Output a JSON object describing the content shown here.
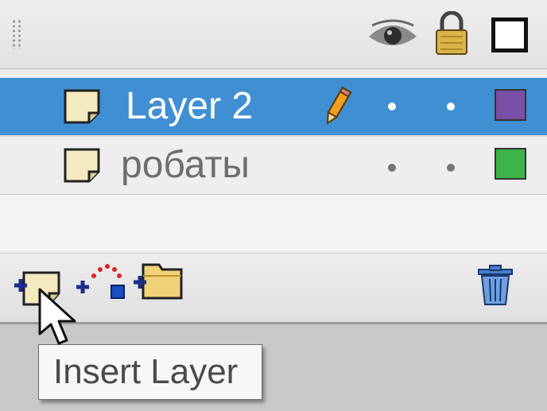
{
  "header": {
    "icons": [
      "eye-icon",
      "lock-icon",
      "outline-icon"
    ]
  },
  "layers": [
    {
      "name": "Layer 2",
      "selected": true,
      "editing": true,
      "color": "#7a4ea6"
    },
    {
      "name": "робаты",
      "selected": false,
      "editing": false,
      "color": "#3bb54a"
    }
  ],
  "toolbar": {
    "buttons": [
      "insert-layer-icon",
      "add-motion-guide-icon",
      "insert-layer-folder-icon",
      "delete-layer-icon"
    ]
  },
  "tooltip": {
    "text": "Insert Layer"
  },
  "colors": {
    "selection": "#3f8fd2"
  }
}
